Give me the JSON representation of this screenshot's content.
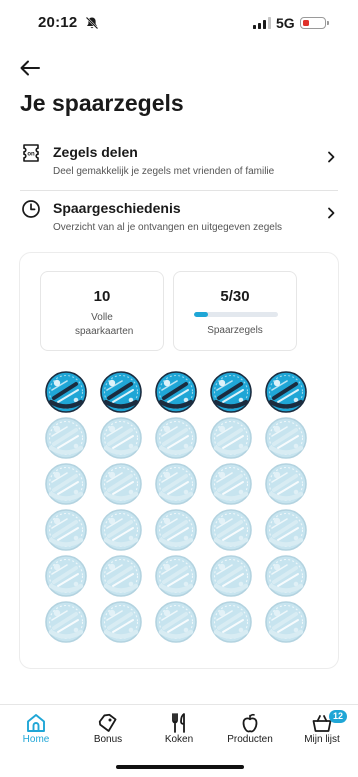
{
  "status_bar": {
    "time": "20:12",
    "network": "5G"
  },
  "header": {
    "title": "Je spaarzegels"
  },
  "menu": [
    {
      "title": "Zegels delen",
      "subtitle": "Deel gemakkelijk je zegels met vrienden of familie",
      "icon": "share-stamps-icon"
    },
    {
      "title": "Spaargeschiedenis",
      "subtitle": "Overzicht van al je ontvangen en uitgegeven zegels",
      "icon": "clock-icon"
    }
  ],
  "stats": {
    "full_cards_value": "10",
    "full_cards_label": "Volle spaarkaarten",
    "stamps_value": "5/30",
    "stamps_label": "Spaarzegels",
    "stamps_progress": 0.1667
  },
  "stamps": {
    "total": 30,
    "collected": 5,
    "stamp_text": "SWEG-zegel"
  },
  "nav": [
    {
      "label": "Home",
      "icon": "home-icon",
      "active": true
    },
    {
      "label": "Bonus",
      "icon": "tag-icon",
      "active": false
    },
    {
      "label": "Koken",
      "icon": "cutlery-icon",
      "active": false
    },
    {
      "label": "Producten",
      "icon": "apple-icon",
      "active": false
    },
    {
      "label": "Mijn lijst",
      "icon": "basket-icon",
      "active": false,
      "badge": "12"
    }
  ],
  "colors": {
    "accent": "#1fa6d6",
    "stamp_dark": "#1b2c3f",
    "stamp_faded": "#c7e4ef"
  }
}
